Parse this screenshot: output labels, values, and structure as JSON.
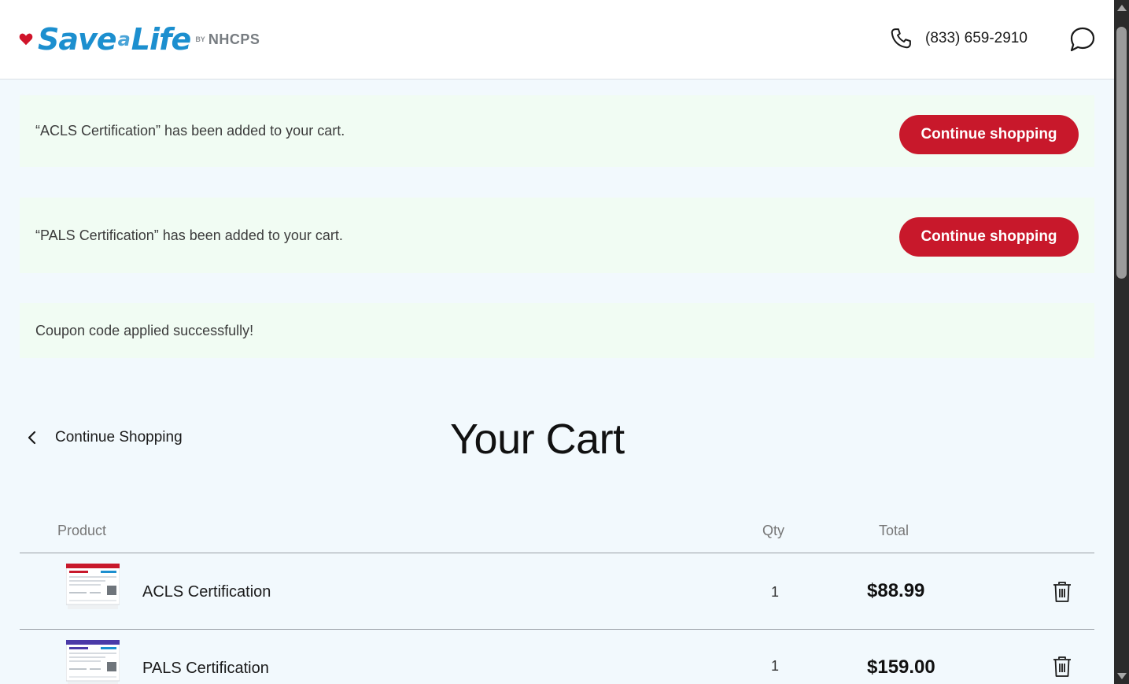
{
  "header": {
    "logo": {
      "save": "Save",
      "a": "a",
      "life": "Life",
      "by": "BY",
      "brand": "NHCPS",
      "heart_color": "#d0142a"
    },
    "phone_icon": "phone-icon",
    "phone_number": "(833) 659-2910",
    "chat_icon": "chat-bubble-icon"
  },
  "notices": [
    {
      "text": "“ACLS Certification” has been added to your cart.",
      "button_label": "Continue shopping"
    },
    {
      "text": "“PALS Certification” has been added to your cart.",
      "button_label": "Continue shopping"
    },
    {
      "text": "Coupon code applied successfully!"
    }
  ],
  "cart": {
    "back_icon": "chevron-left-icon",
    "back_label": "Continue Shopping",
    "title": "Your Cart",
    "columns": {
      "product": "Product",
      "qty": "Qty",
      "total": "Total"
    },
    "items": [
      {
        "name": "ACLS Certification",
        "qty": "1",
        "price": "$88.99",
        "card_color": "#c8182b"
      },
      {
        "name": "PALS Certification",
        "qty": "1",
        "price": "$159.00",
        "card_color": "#4b3aa8"
      }
    ],
    "delete_icon": "trash-icon"
  },
  "colors": {
    "accent": "#c8182b",
    "brand_blue": "#1c8fcf",
    "page_bg": "#f2f9fd",
    "notice_bg": "#f1fcf3"
  }
}
